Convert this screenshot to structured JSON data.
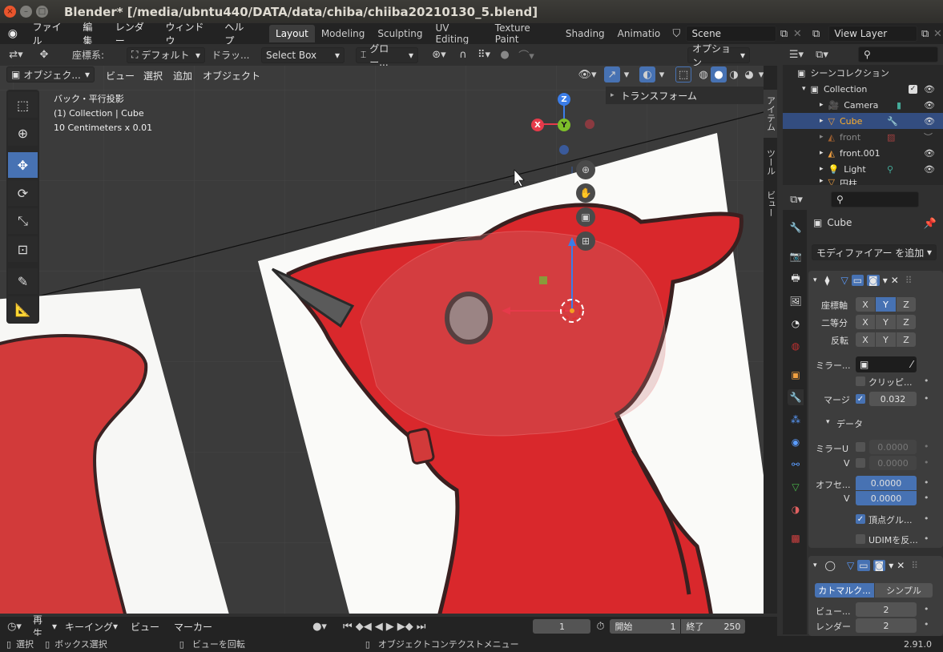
{
  "window": {
    "title": "Blender* [/media/ubntu440/DATA/data/chiba/chiiba20210130_5.blend]",
    "close": "×",
    "min": "–",
    "max": "□"
  },
  "menu": {
    "items": [
      "ファイル",
      "編集",
      "レンダー",
      "ウィンドウ",
      "ヘルプ"
    ],
    "workspaces": [
      "Layout",
      "Modeling",
      "Sculpting",
      "UV Editing",
      "Texture Paint",
      "Shading",
      "Animatio"
    ],
    "scene": "Scene",
    "viewlayer": "View Layer"
  },
  "header": {
    "coord_label": "座標系:",
    "coord_value": "デフォルト",
    "drag_label": "ドラッ...",
    "drag_value": "Select Box",
    "orient_value": "グロー...",
    "options": "オプション"
  },
  "viewport_header": {
    "mode": "オブジェク...",
    "menus": [
      "ビュー",
      "選択",
      "追加",
      "オブジェクト"
    ]
  },
  "overlay": {
    "line1": "バック・平行投影",
    "line2": "(1) Collection | Cube",
    "line3": "10 Centimeters x 0.01"
  },
  "gizmo": {
    "z": "Z",
    "y": "Y",
    "x": "X"
  },
  "npanel": {
    "tabs": [
      "アイテム",
      "ツール",
      "ビュー"
    ],
    "transform": "トランスフォーム"
  },
  "outliner": {
    "scene_collection": "シーンコレクション",
    "rows": [
      {
        "name": "Collection"
      },
      {
        "name": "Camera"
      },
      {
        "name": "Cube"
      },
      {
        "name": "front"
      },
      {
        "name": "front.001"
      },
      {
        "name": "Light"
      },
      {
        "name": "円柱"
      }
    ]
  },
  "properties": {
    "object": "Cube",
    "add_modifier": "モディファイアー を追加",
    "mirror": {
      "axis_label": "座標軸",
      "bisect_label": "二等分",
      "flip_label": "反転",
      "x": "X",
      "y": "Y",
      "z": "Z",
      "mirror_obj": "ミラー...",
      "clipping": "クリッピ...",
      "merge": "マージ",
      "merge_value": "0.032",
      "data_section": "データ",
      "mirror_u": "ミラーU",
      "v": "V",
      "mirror_u_value": "0.0000",
      "mirror_v_value": "0.0000",
      "offset": "オフセ...",
      "offset_u_value": "0.0000",
      "offset_v_value": "0.0000",
      "vertex_groups": "頂点グル...",
      "udim": "UDIMを反..."
    },
    "subsurf": {
      "catmull": "カトマルク...",
      "simple": "シンプル",
      "viewport": "ビュー...",
      "viewport_value": "2",
      "render": "レンダー",
      "render_value": "2"
    }
  },
  "timeline": {
    "play": "再生",
    "keying": "キーイング",
    "view": "ビュー",
    "marker": "マーカー",
    "frame": "1",
    "start_label": "開始",
    "start": "1",
    "end_label": "終了",
    "end": "250"
  },
  "status": {
    "select": "選択",
    "box_select": "ボックス選択",
    "rotate_view": "ビューを回転",
    "context_menu": "オブジェクトコンテクストメニュー",
    "version": "2.91.0"
  }
}
